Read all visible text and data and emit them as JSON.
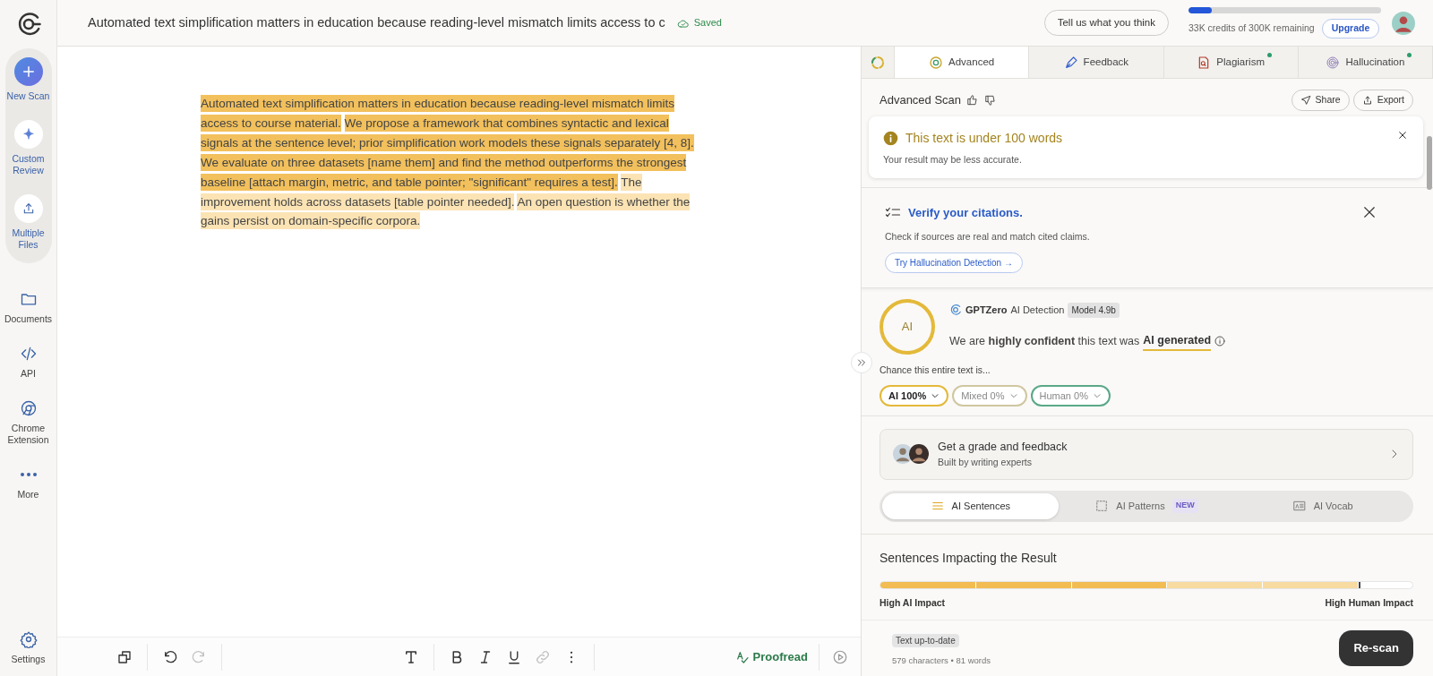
{
  "header": {
    "document_title": "Automated text simplification matters in education because reading-level mismatch limits access to c",
    "save_status": "Saved",
    "feedback_button": "Tell us what you think",
    "credits": {
      "level": 0.12,
      "text": "33K credits of 300K remaining"
    },
    "upgrade_button": "Upgrade"
  },
  "sidebar": {
    "primary": [
      {
        "label": "New Scan",
        "kind": "new"
      },
      {
        "label": "Custom Review",
        "kind": "sparkle"
      },
      {
        "label": "Multiple Files",
        "kind": "upload"
      }
    ],
    "items": [
      {
        "label": "Documents",
        "kind": "folder"
      },
      {
        "label": "API",
        "kind": "code"
      },
      {
        "label": "Chrome Extension",
        "kind": "chrome"
      },
      {
        "label": "More",
        "kind": "dots"
      }
    ],
    "settings": "Settings"
  },
  "editor": {
    "sentences": [
      {
        "text": "Automated text simplification matters in education because reading-level mismatch limits access to course material.",
        "color": "#f2c05c"
      },
      {
        "text": "We propose a framework that combines syntactic and lexical signals at the sentence level; prior simplification work models these signals separately [4, 8].",
        "color": "#f2c05c"
      },
      {
        "text": "We evaluate on three datasets [name them] and find the method outperforms the strongest baseline [attach margin, metric, and table pointer; \"significant\" requires a test].",
        "color": "#f2c05c"
      },
      {
        "text": "The improvement holds across datasets [table pointer needed].",
        "color": "#fbe3b4"
      },
      {
        "text": "An open question is whether the gains persist on domain-specific corpora.",
        "color": "#fbe3b4"
      }
    ],
    "toolbar": {
      "groups": [
        [
          {
            "kind": "copy",
            "disabled": false
          }
        ],
        [
          {
            "kind": "undo",
            "disabled": false
          },
          {
            "kind": "redo",
            "disabled": true
          }
        ],
        [
          {
            "kind": "text",
            "disabled": false
          }
        ],
        [
          {
            "kind": "bold",
            "disabled": false
          },
          {
            "kind": "italic",
            "disabled": false
          },
          {
            "kind": "underline",
            "disabled": false
          },
          {
            "kind": "link",
            "disabled": true
          },
          {
            "kind": "more",
            "disabled": false
          }
        ]
      ],
      "proofread": "Proofread"
    }
  },
  "panel": {
    "tabs": [
      {
        "label": "Advanced",
        "kind": "advanced",
        "selected": true,
        "dot": false
      },
      {
        "label": "Feedback",
        "kind": "feedback",
        "selected": false,
        "dot": false
      },
      {
        "label": "Plagiarism",
        "kind": "plagiarism",
        "selected": false,
        "dot": true
      },
      {
        "label": "Hallucination",
        "kind": "hallucination",
        "selected": false,
        "dot": true
      }
    ],
    "scan_title": "Advanced Scan",
    "share_button": "Share",
    "export_button": "Export",
    "alert": {
      "title": "This text is under 100 words",
      "body": "Your result may be less accurate."
    },
    "citations": {
      "title": "Verify your citations.",
      "body": "Check if sources are real and match cited claims.",
      "button": "Try Hallucination Detection →"
    },
    "detection": {
      "brand": "GPTZero",
      "product": "AI Detection",
      "model": "Model 4.9b",
      "score_label": "AI",
      "statement": "We are **highly confident** this text was",
      "verdict": "AI generated",
      "chance_label": "Chance this entire text is...",
      "chances": [
        {
          "label": "AI 100%",
          "kind": "ai",
          "selected": true
        },
        {
          "label": "Mixed 0%",
          "kind": "mixed",
          "selected": false
        },
        {
          "label": "Human 0%",
          "kind": "human",
          "selected": false
        }
      ]
    },
    "grade": {
      "title": "Get a grade and feedback",
      "subtitle": "Built by writing experts"
    },
    "modes": [
      {
        "label": "AI Sentences",
        "kind": "lines",
        "selected": true
      },
      {
        "label": "AI Patterns",
        "kind": "dashed",
        "selected": false,
        "badge": "NEW"
      },
      {
        "label": "AI Vocab",
        "kind": "vocab",
        "selected": false
      }
    ],
    "impact": {
      "title": "Sentences Impacting the Result",
      "segments": [
        {
          "color": "#f2bc52"
        },
        {
          "color": "#f2bc52"
        },
        {
          "color": "#f2bc52"
        },
        {
          "color": "#f7dba0"
        },
        {
          "color": "#f7dba0"
        }
      ],
      "left_label": "High AI Impact",
      "right_label": "High Human Impact"
    },
    "footer": {
      "status": "Text up-to-date",
      "stats": "579 characters • 81 words",
      "rescan_button": "Re-scan"
    }
  }
}
